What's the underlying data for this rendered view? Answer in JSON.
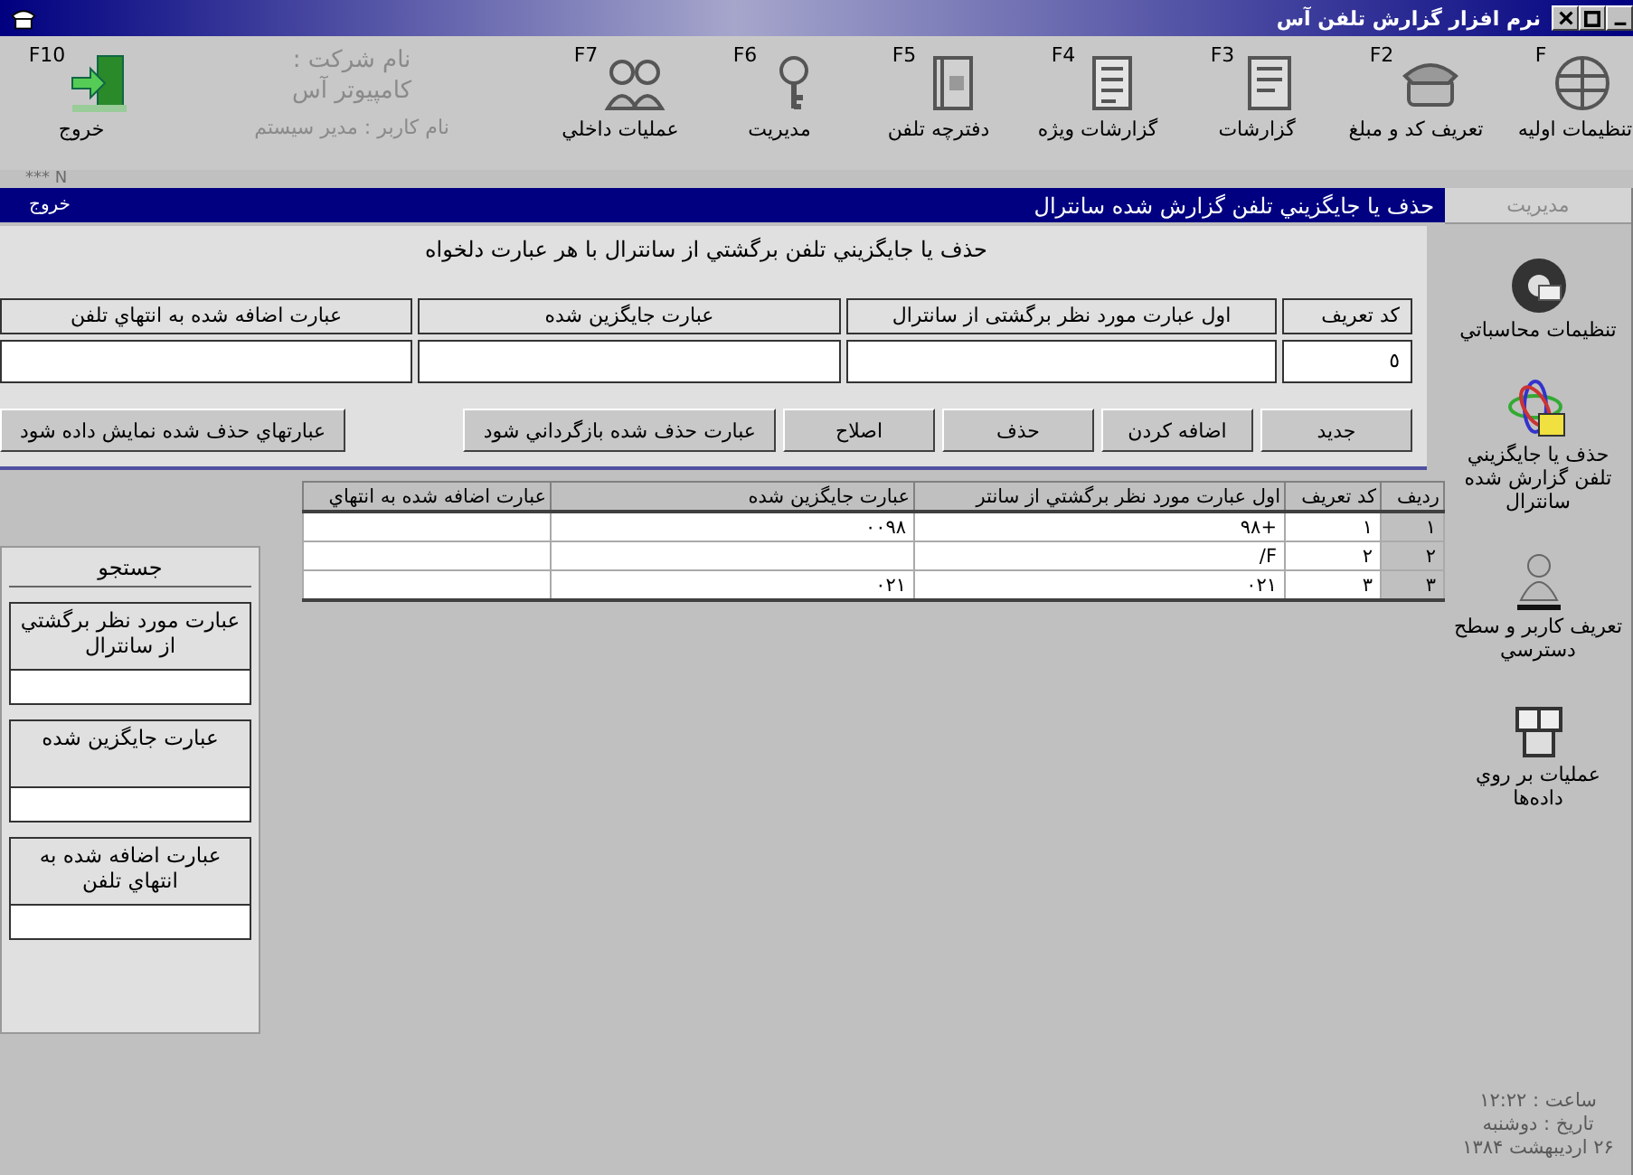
{
  "window": {
    "title": "نرم افزار گزارش تلفن آس"
  },
  "toolbar": {
    "items": [
      {
        "key": "F",
        "label": "تنظيمات اوليه"
      },
      {
        "key": "F2",
        "label": "تعريف كد و مبلغ"
      },
      {
        "key": "F3",
        "label": "گزارشات"
      },
      {
        "key": "F4",
        "label": "گزارشات ويژه"
      },
      {
        "key": "F5",
        "label": "دفترچه تلفن"
      },
      {
        "key": "F6",
        "label": "مديريت"
      },
      {
        "key": "F7",
        "label": "عمليات داخلي"
      }
    ],
    "company_label": "نام شركت :",
    "company_name": "كامپيوتر آس",
    "user": "نام كاربر : مدير سيستم",
    "exit": {
      "key": "F10",
      "label": "خروج"
    }
  },
  "status_code": "*** N",
  "header_bar": {
    "title": "حذف يا جايگزيني تلفن گزارش شده سانترال",
    "exit_link": "خروج"
  },
  "form": {
    "heading": "حذف يا جايگزيني تلفن برگشتي از سانترال با هر عبارت دلخواه",
    "fields": [
      {
        "label": "كد تعريف",
        "value": "٥"
      },
      {
        "label": "اول عبارت مورد نظر برگشتی از سانترال"
      },
      {
        "label": "عبارت جايگزين شده"
      },
      {
        "label": "عبارت اضافه شده به انتهاي تلفن"
      }
    ],
    "buttons": [
      "جديد",
      "اضافه كردن",
      "حذف",
      "اصلاح",
      "عبارت حذف شده بازگرداني شود"
    ],
    "show_deleted_button": "عبارتهاي حذف شده نمايش داده شود"
  },
  "table": {
    "columns": [
      "رديف",
      "كد تعريف",
      "اول عبارت مورد نظر برگشتي از سانتر",
      "عبارت جايگزين شده",
      "عبارت اضافه شده به انتهاي"
    ],
    "rows": [
      [
        "۱",
        "۱",
        "۹۸+",
        "۰۰۹۸",
        ""
      ],
      [
        "۲",
        "۲",
        "/F",
        "",
        ""
      ],
      [
        "۳",
        "۳",
        "۰۲۱",
        "۰۲۱",
        ""
      ]
    ]
  },
  "search": {
    "title": "جستجو",
    "fields": [
      {
        "label": "عبارت مورد نظر برگشتي از سانترال"
      },
      {
        "label": "عبارت جايگزين شده"
      },
      {
        "label": "عبارت اضافه شده به انتهاي تلفن"
      }
    ]
  },
  "sidebar": {
    "tab": "مديريت",
    "items": [
      {
        "label": "تنظيمات محاسباتي"
      },
      {
        "label": "حذف يا جايگزيني تلفن گزارش شده سانترال"
      },
      {
        "label": "تعريف كاربر و سطح دسترسي"
      },
      {
        "label": "عمليات بر روي داده‌ها"
      }
    ],
    "time": "ساعت :  ۱۲:۲۲",
    "date": "تاريخ :  دوشنبه",
    "date_full": "۲۶ ارديبهشت ۱۳۸۴"
  }
}
